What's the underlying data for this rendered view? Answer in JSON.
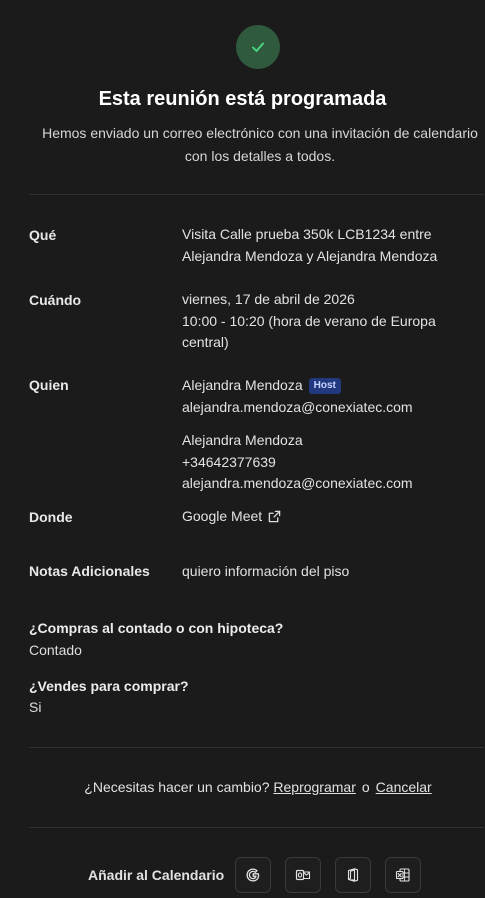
{
  "header": {
    "title": "Esta reunión está programada",
    "subtitle": "Hemos enviado un correo electrónico con una invitación de calendario con los detalles a todos."
  },
  "details": {
    "what": {
      "label": "Qué",
      "lines": [
        "Visita Calle prueba 350k LCB1234 entre",
        "Alejandra Mendoza y Alejandra Mendoza"
      ]
    },
    "when": {
      "label": "Cuándo",
      "lines": [
        "viernes, 17 de abril de 2026",
        "10:00 - 10:20 (hora de verano de Europa",
        "central)"
      ]
    },
    "who": {
      "label": "Quien",
      "host": {
        "name": "Alejandra Mendoza",
        "badge": "Host",
        "email": "alejandra.mendoza@conexiatec.com"
      },
      "attendee": {
        "name": "Alejandra Mendoza",
        "phone": "+34642377639",
        "email": "alejandra.mendoza@conexiatec.com"
      }
    },
    "where": {
      "label": "Donde",
      "value": "Google Meet",
      "icon": "external-link-icon"
    },
    "notes": {
      "label": "Notas Adicionales",
      "value": "quiero información del piso"
    }
  },
  "questions": [
    {
      "question": "¿Compras al contado o con hipoteca?",
      "answer": "Contado"
    },
    {
      "question": "¿Vendes para comprar?",
      "answer": "Si"
    }
  ],
  "change": {
    "prompt": "¿Necesitas hacer un cambio?",
    "reschedule": "Reprogramar",
    "or": "o",
    "cancel": "Cancelar"
  },
  "calendar": {
    "label": "Añadir al Calendario",
    "buttons": [
      "google-icon",
      "outlook-icon",
      "office-icon",
      "ics-file-icon"
    ]
  },
  "colors": {
    "success_bg": "#2f5a3e",
    "success_check": "#4ade80",
    "host_badge_bg": "#22397f",
    "background": "#1b1b1b"
  }
}
